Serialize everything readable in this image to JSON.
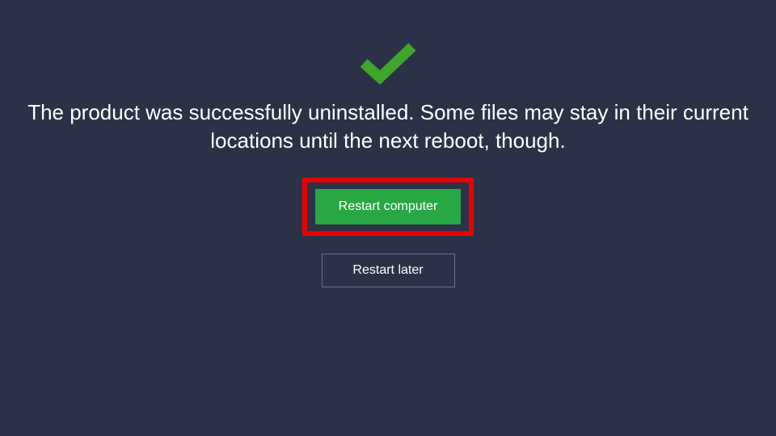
{
  "icon": "checkmark",
  "message": "The product was successfully uninstalled. Some files may stay in their current locations until the next reboot, though.",
  "buttons": {
    "primary_label": "Restart computer",
    "secondary_label": "Restart later"
  },
  "colors": {
    "background": "#2b3146",
    "accent": "#28a745",
    "highlight": "#e60000"
  }
}
